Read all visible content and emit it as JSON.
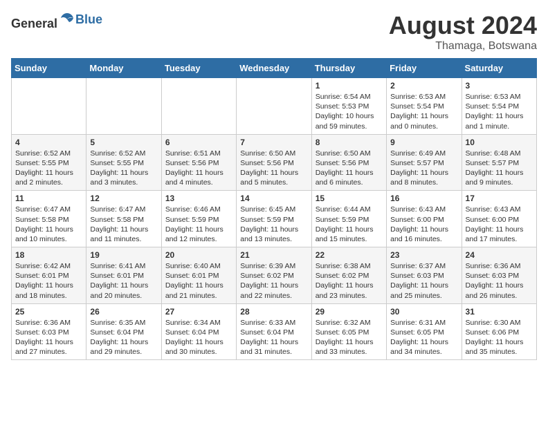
{
  "header": {
    "logo_general": "General",
    "logo_blue": "Blue",
    "month_year": "August 2024",
    "location": "Thamaga, Botswana"
  },
  "days_of_week": [
    "Sunday",
    "Monday",
    "Tuesday",
    "Wednesday",
    "Thursday",
    "Friday",
    "Saturday"
  ],
  "weeks": [
    [
      {
        "day": "",
        "data": ""
      },
      {
        "day": "",
        "data": ""
      },
      {
        "day": "",
        "data": ""
      },
      {
        "day": "",
        "data": ""
      },
      {
        "day": "1",
        "data": "Sunrise: 6:54 AM\nSunset: 5:53 PM\nDaylight: 10 hours and 59 minutes."
      },
      {
        "day": "2",
        "data": "Sunrise: 6:53 AM\nSunset: 5:54 PM\nDaylight: 11 hours and 0 minutes."
      },
      {
        "day": "3",
        "data": "Sunrise: 6:53 AM\nSunset: 5:54 PM\nDaylight: 11 hours and 1 minute."
      }
    ],
    [
      {
        "day": "4",
        "data": "Sunrise: 6:52 AM\nSunset: 5:55 PM\nDaylight: 11 hours and 2 minutes."
      },
      {
        "day": "5",
        "data": "Sunrise: 6:52 AM\nSunset: 5:55 PM\nDaylight: 11 hours and 3 minutes."
      },
      {
        "day": "6",
        "data": "Sunrise: 6:51 AM\nSunset: 5:56 PM\nDaylight: 11 hours and 4 minutes."
      },
      {
        "day": "7",
        "data": "Sunrise: 6:50 AM\nSunset: 5:56 PM\nDaylight: 11 hours and 5 minutes."
      },
      {
        "day": "8",
        "data": "Sunrise: 6:50 AM\nSunset: 5:56 PM\nDaylight: 11 hours and 6 minutes."
      },
      {
        "day": "9",
        "data": "Sunrise: 6:49 AM\nSunset: 5:57 PM\nDaylight: 11 hours and 8 minutes."
      },
      {
        "day": "10",
        "data": "Sunrise: 6:48 AM\nSunset: 5:57 PM\nDaylight: 11 hours and 9 minutes."
      }
    ],
    [
      {
        "day": "11",
        "data": "Sunrise: 6:47 AM\nSunset: 5:58 PM\nDaylight: 11 hours and 10 minutes."
      },
      {
        "day": "12",
        "data": "Sunrise: 6:47 AM\nSunset: 5:58 PM\nDaylight: 11 hours and 11 minutes."
      },
      {
        "day": "13",
        "data": "Sunrise: 6:46 AM\nSunset: 5:59 PM\nDaylight: 11 hours and 12 minutes."
      },
      {
        "day": "14",
        "data": "Sunrise: 6:45 AM\nSunset: 5:59 PM\nDaylight: 11 hours and 13 minutes."
      },
      {
        "day": "15",
        "data": "Sunrise: 6:44 AM\nSunset: 5:59 PM\nDaylight: 11 hours and 15 minutes."
      },
      {
        "day": "16",
        "data": "Sunrise: 6:43 AM\nSunset: 6:00 PM\nDaylight: 11 hours and 16 minutes."
      },
      {
        "day": "17",
        "data": "Sunrise: 6:43 AM\nSunset: 6:00 PM\nDaylight: 11 hours and 17 minutes."
      }
    ],
    [
      {
        "day": "18",
        "data": "Sunrise: 6:42 AM\nSunset: 6:01 PM\nDaylight: 11 hours and 18 minutes."
      },
      {
        "day": "19",
        "data": "Sunrise: 6:41 AM\nSunset: 6:01 PM\nDaylight: 11 hours and 20 minutes."
      },
      {
        "day": "20",
        "data": "Sunrise: 6:40 AM\nSunset: 6:01 PM\nDaylight: 11 hours and 21 minutes."
      },
      {
        "day": "21",
        "data": "Sunrise: 6:39 AM\nSunset: 6:02 PM\nDaylight: 11 hours and 22 minutes."
      },
      {
        "day": "22",
        "data": "Sunrise: 6:38 AM\nSunset: 6:02 PM\nDaylight: 11 hours and 23 minutes."
      },
      {
        "day": "23",
        "data": "Sunrise: 6:37 AM\nSunset: 6:03 PM\nDaylight: 11 hours and 25 minutes."
      },
      {
        "day": "24",
        "data": "Sunrise: 6:36 AM\nSunset: 6:03 PM\nDaylight: 11 hours and 26 minutes."
      }
    ],
    [
      {
        "day": "25",
        "data": "Sunrise: 6:36 AM\nSunset: 6:03 PM\nDaylight: 11 hours and 27 minutes."
      },
      {
        "day": "26",
        "data": "Sunrise: 6:35 AM\nSunset: 6:04 PM\nDaylight: 11 hours and 29 minutes."
      },
      {
        "day": "27",
        "data": "Sunrise: 6:34 AM\nSunset: 6:04 PM\nDaylight: 11 hours and 30 minutes."
      },
      {
        "day": "28",
        "data": "Sunrise: 6:33 AM\nSunset: 6:04 PM\nDaylight: 11 hours and 31 minutes."
      },
      {
        "day": "29",
        "data": "Sunrise: 6:32 AM\nSunset: 6:05 PM\nDaylight: 11 hours and 33 minutes."
      },
      {
        "day": "30",
        "data": "Sunrise: 6:31 AM\nSunset: 6:05 PM\nDaylight: 11 hours and 34 minutes."
      },
      {
        "day": "31",
        "data": "Sunrise: 6:30 AM\nSunset: 6:06 PM\nDaylight: 11 hours and 35 minutes."
      }
    ]
  ]
}
